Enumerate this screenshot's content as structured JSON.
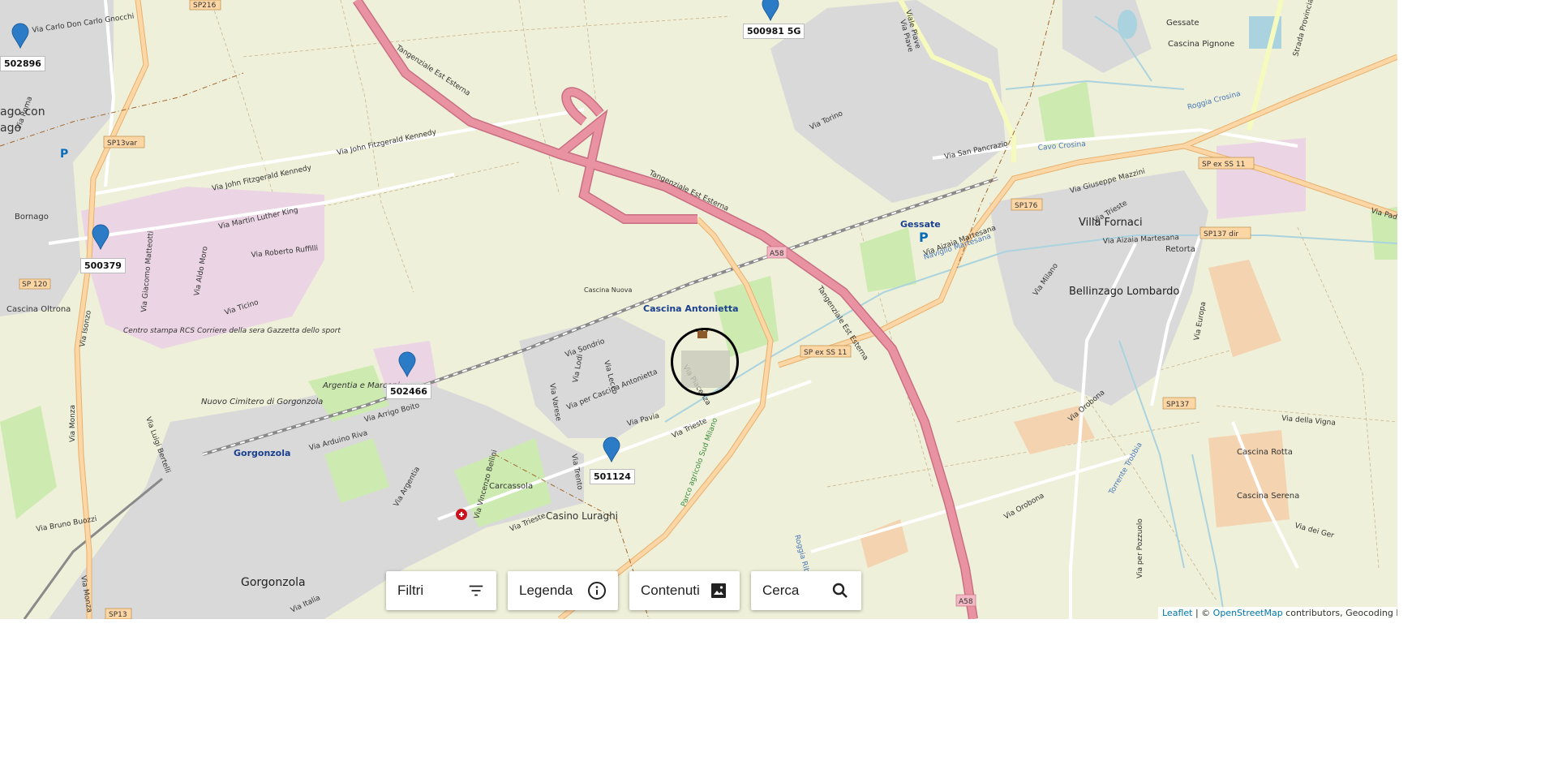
{
  "map": {
    "colors": {
      "land": "#eef0d9",
      "urban": "#d9d9d9",
      "industrial": "#ebd5e5",
      "park": "#cdebb0",
      "motorway": "#e892a2",
      "primary": "#fcd6a4",
      "secondary": "#f7fabf",
      "water": "#aad3df",
      "pin": "#2b7bc6",
      "boundary": "#a0652c"
    },
    "place_labels": [
      "Gorgonzola",
      "Gorgonzola",
      "Bellinzago Lombardo",
      "Villa Fornaci",
      "Gessate",
      "Cascina Antonietta",
      "Bornago",
      "Cascina Oltrona",
      "Cascina Pignone",
      "Gessate",
      "Retorta",
      "Carcassola",
      "Casino Luraghi",
      "Cascina Nuova",
      "Cascina Rotta",
      "Cascina Serena",
      "Argentia e Marconi",
      "Nuovo Cimitero di Gorgonzola",
      "Centro stampa RCS Corriere della sera Gazzetta dello sport",
      "ago con",
      "ago"
    ],
    "road_labels": [
      "Tangenziale Est Esterna",
      "Tangenziale Est Esterna",
      "Tangenziale Est Esterna",
      "Via Monza",
      "Via Monza",
      "Via Luigi Bertelli",
      "Via John Fitzgerald Kennedy",
      "Via John Fitzgerald Kennedy",
      "Via Martin Luther King",
      "Via Roberto Ruffilli",
      "Via Ticino",
      "Via Trieste",
      "Via Trieste",
      "Via Trieste",
      "Via per Pozzuolo",
      "Via Europa",
      "Via Orobona",
      "Via Orobona",
      "Via San Pancrazio",
      "Via Torino",
      "Via Giuseppe Mazzini",
      "Via Aizaia Martesana",
      "Via Aizaia Martesana",
      "Via Padana",
      "Via Milano",
      "Via della Vigna",
      "Via dei Ger",
      "Via Isonzo",
      "Via Arrigo Boito",
      "Via Arduino Riva",
      "Via per Cascina Antonietta",
      "Via Sondrio",
      "Via Varese",
      "Via Lodi",
      "Via Lecco",
      "Via Pavia",
      "Via Piacenza",
      "Via Trento",
      "Strada Provinciale",
      "Via Roma",
      "Via Bruno Buozzi",
      "Via Italia",
      "Via Argentia",
      "Via Vincenzo Bellini",
      "Via Piave",
      "Viale Piave",
      "Via Aldo Moro",
      "Via Giacomo Matteotti",
      "Via Carlo Don Carlo Gnocchi",
      "Parco agricolo Sud Milano",
      "Roggia Crosina",
      "Cavo Crosina",
      "Naviglio Martesana",
      "Torrente Trobbia",
      "Roggia Ribolta"
    ],
    "shields": [
      "SP216",
      "SP13var",
      "SP ex SS 11",
      "SP ex SS 11",
      "SP176",
      "SP137 dir",
      "SP137",
      "SP 120",
      "SP13",
      "A58",
      "A58"
    ],
    "pins": [
      {
        "label": "502896"
      },
      {
        "label": "500981 5G"
      },
      {
        "label": "500379"
      },
      {
        "label": "502466"
      },
      {
        "label": "501124"
      }
    ]
  },
  "controls": {
    "filtri": {
      "label": "Filtri",
      "icon": "filter-list-icon"
    },
    "legenda": {
      "label": "Legenda",
      "icon": "info-icon"
    },
    "contenuti": {
      "label": "Contenuti",
      "icon": "image-icon"
    },
    "cerca": {
      "label": "Cerca",
      "icon": "search-icon"
    }
  },
  "attribution": {
    "leaflet": "Leaflet",
    "separator": " | © ",
    "osm": "OpenStreetMap",
    "rest": " contributors, Geocoding by Es"
  }
}
